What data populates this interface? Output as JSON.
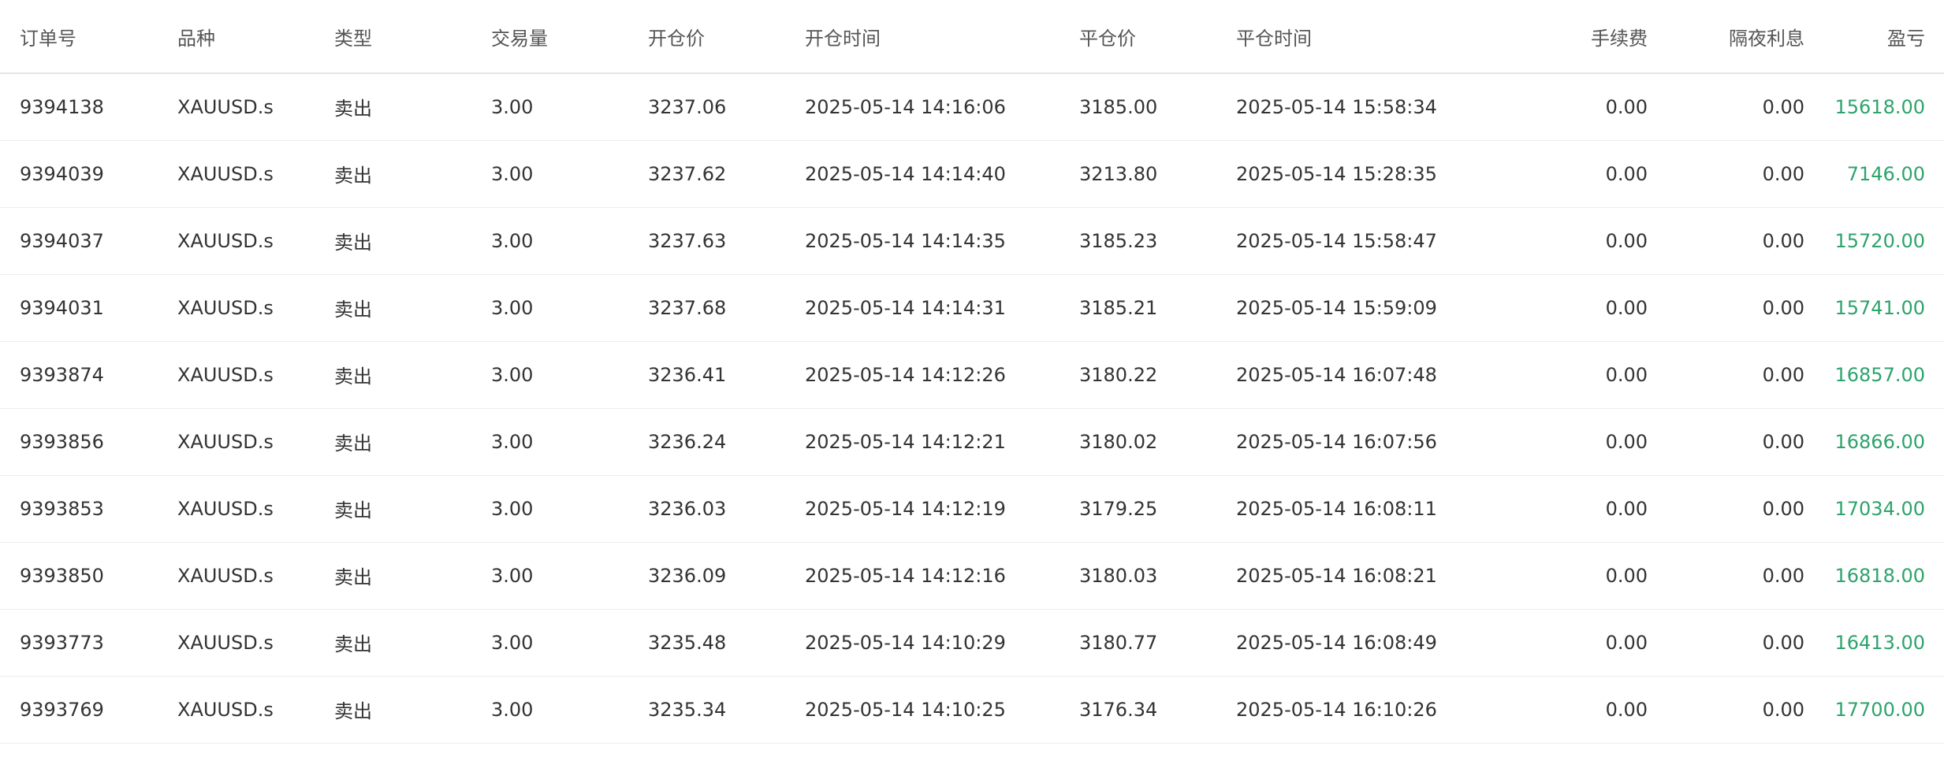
{
  "table": {
    "columns": [
      "订单号",
      "品种",
      "类型",
      "交易量",
      "开仓价",
      "开仓时间",
      "平仓价",
      "平仓时间",
      "手续费",
      "隔夜利息",
      "盈亏"
    ],
    "rows": [
      [
        "9394138",
        "XAUUSD.s",
        "卖出",
        "3.00",
        "3237.06",
        "2025-05-14 14:16:06",
        "3185.00",
        "2025-05-14 15:58:34",
        "0.00",
        "0.00",
        "15618.00"
      ],
      [
        "9394039",
        "XAUUSD.s",
        "卖出",
        "3.00",
        "3237.62",
        "2025-05-14 14:14:40",
        "3213.80",
        "2025-05-14 15:28:35",
        "0.00",
        "0.00",
        "7146.00"
      ],
      [
        "9394037",
        "XAUUSD.s",
        "卖出",
        "3.00",
        "3237.63",
        "2025-05-14 14:14:35",
        "3185.23",
        "2025-05-14 15:58:47",
        "0.00",
        "0.00",
        "15720.00"
      ],
      [
        "9394031",
        "XAUUSD.s",
        "卖出",
        "3.00",
        "3237.68",
        "2025-05-14 14:14:31",
        "3185.21",
        "2025-05-14 15:59:09",
        "0.00",
        "0.00",
        "15741.00"
      ],
      [
        "9393874",
        "XAUUSD.s",
        "卖出",
        "3.00",
        "3236.41",
        "2025-05-14 14:12:26",
        "3180.22",
        "2025-05-14 16:07:48",
        "0.00",
        "0.00",
        "16857.00"
      ],
      [
        "9393856",
        "XAUUSD.s",
        "卖出",
        "3.00",
        "3236.24",
        "2025-05-14 14:12:21",
        "3180.02",
        "2025-05-14 16:07:56",
        "0.00",
        "0.00",
        "16866.00"
      ],
      [
        "9393853",
        "XAUUSD.s",
        "卖出",
        "3.00",
        "3236.03",
        "2025-05-14 14:12:19",
        "3179.25",
        "2025-05-14 16:08:11",
        "0.00",
        "0.00",
        "17034.00"
      ],
      [
        "9393850",
        "XAUUSD.s",
        "卖出",
        "3.00",
        "3236.09",
        "2025-05-14 14:12:16",
        "3180.03",
        "2025-05-14 16:08:21",
        "0.00",
        "0.00",
        "16818.00"
      ],
      [
        "9393773",
        "XAUUSD.s",
        "卖出",
        "3.00",
        "3235.48",
        "2025-05-14 14:10:29",
        "3180.77",
        "2025-05-14 16:08:49",
        "0.00",
        "0.00",
        "16413.00"
      ],
      [
        "9393769",
        "XAUUSD.s",
        "卖出",
        "3.00",
        "3235.34",
        "2025-05-14 14:10:25",
        "3176.34",
        "2025-05-14 16:10:26",
        "0.00",
        "0.00",
        "17700.00"
      ]
    ]
  },
  "colors": {
    "profit_positive": "#2ea36c",
    "header_text": "#555555",
    "cell_text": "#333333",
    "row_divider": "#eeeeee"
  }
}
